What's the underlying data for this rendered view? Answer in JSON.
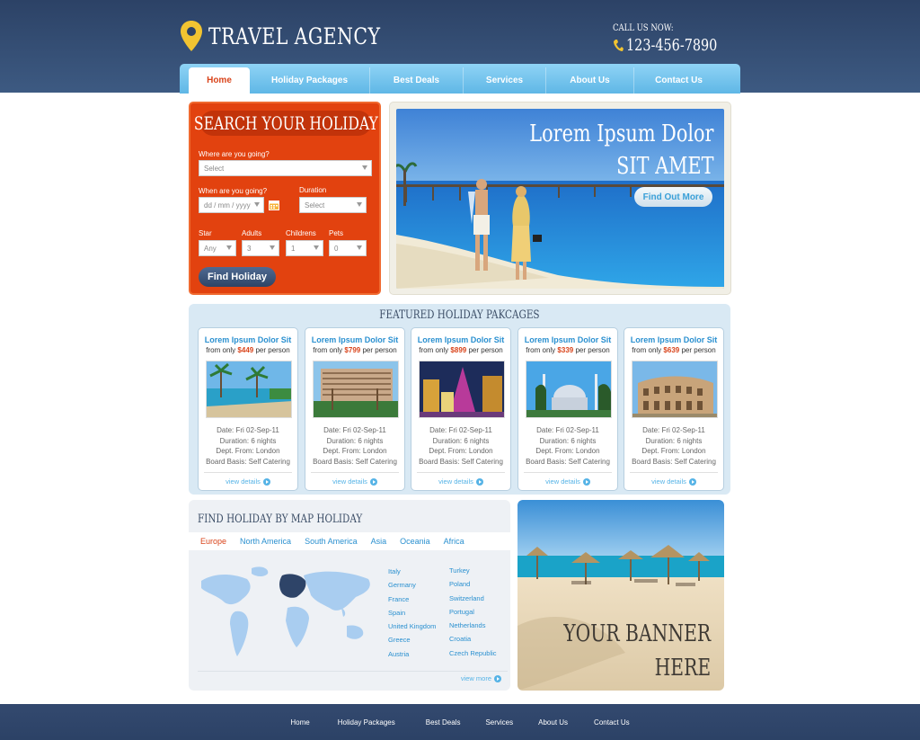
{
  "header": {
    "logo_title": "TRAVEL AGENCY",
    "call_label": "CALL US NOW:",
    "phone": "123-456-7890"
  },
  "nav": {
    "items": [
      "Home",
      "Holiday Packages",
      "Best Deals",
      "Services",
      "About Us",
      "Contact Us"
    ],
    "active": "Home"
  },
  "search": {
    "title": "SEARCH YOUR HOLIDAY",
    "where_label": "Where are you going?",
    "where_value": "Select",
    "when_label": "When are you going?",
    "when_value": "dd / mm / yyyy",
    "duration_label": "Duration",
    "duration_value": "Select",
    "star_label": "Star",
    "star_value": "Any",
    "adults_label": "Adults",
    "adults_value": "3",
    "children_label": "Childrens",
    "children_value": "1",
    "pets_label": "Pets",
    "pets_value": "0",
    "button": "Find Holiday"
  },
  "hero": {
    "title_line1": "Lorem Ipsum Dolor",
    "title_line2": "SIT AMET",
    "button": "Find Out More"
  },
  "featured": {
    "title": "FEATURED HOLIDAY PAKCAGES",
    "cards": [
      {
        "title": "Lorem Ipsum Dolor Sit",
        "price_prefix": "from only",
        "price": "$449",
        "price_suffix": "per person",
        "date": "Date: Fri 02-Sep-11",
        "duration": "Duration: 6 nights",
        "dept": "Dept. From: London",
        "board": "Board Basis: Self Catering",
        "more": "view details"
      },
      {
        "title": "Lorem Ipsum Dolor Sit",
        "price_prefix": "from only",
        "price": "$799",
        "price_suffix": "per person",
        "date": "Date: Fri 02-Sep-11",
        "duration": "Duration: 6 nights",
        "dept": "Dept. From: London",
        "board": "Board Basis: Self Catering",
        "more": "view details"
      },
      {
        "title": "Lorem Ipsum Dolor Sit",
        "price_prefix": "from only",
        "price": "$899",
        "price_suffix": "per person",
        "date": "Date: Fri 02-Sep-11",
        "duration": "Duration: 6 nights",
        "dept": "Dept. From: London",
        "board": "Board Basis: Self Catering",
        "more": "view details"
      },
      {
        "title": "Lorem Ipsum Dolor Sit",
        "price_prefix": "from only",
        "price": "$339",
        "price_suffix": "per person",
        "date": "Date: Fri 02-Sep-11",
        "duration": "Duration: 6 nights",
        "dept": "Dept. From: London",
        "board": "Board Basis: Self Catering",
        "more": "view details"
      },
      {
        "title": "Lorem Ipsum Dolor Sit",
        "price_prefix": "from only",
        "price": "$639",
        "price_suffix": "per person",
        "date": "Date: Fri 02-Sep-11",
        "duration": "Duration: 6 nights",
        "dept": "Dept. From: London",
        "board": "Board Basis: Self Catering",
        "more": "view details"
      }
    ]
  },
  "map": {
    "title": "FIND HOLIDAY BY MAP HOLIDAY",
    "tabs": [
      "Europe",
      "North America",
      "South America",
      "Asia",
      "Oceania",
      "Africa"
    ],
    "active_tab": "Europe",
    "countries_col1": [
      "Italy",
      "Germany",
      "France",
      "Spain",
      "United Kingdom",
      "Greece",
      "Austria"
    ],
    "countries_col2": [
      "Turkey",
      "Poland",
      "Switzerland",
      "Portugal",
      "Netherlands",
      "Croatia",
      "Czech Republic"
    ],
    "more": "view more"
  },
  "banner": {
    "line1": "YOUR BANNER",
    "line2": "HERE"
  },
  "footer": {
    "links": [
      "Home",
      "Holiday Packages",
      "Best Deals",
      "Services",
      "About Us",
      "Contact Us"
    ]
  },
  "colors": {
    "header": "#2c4266",
    "nav": "#5fb7e6",
    "search_panel": "#e2420f",
    "accent_price": "#d9441b",
    "link_blue": "#2a90d0"
  }
}
